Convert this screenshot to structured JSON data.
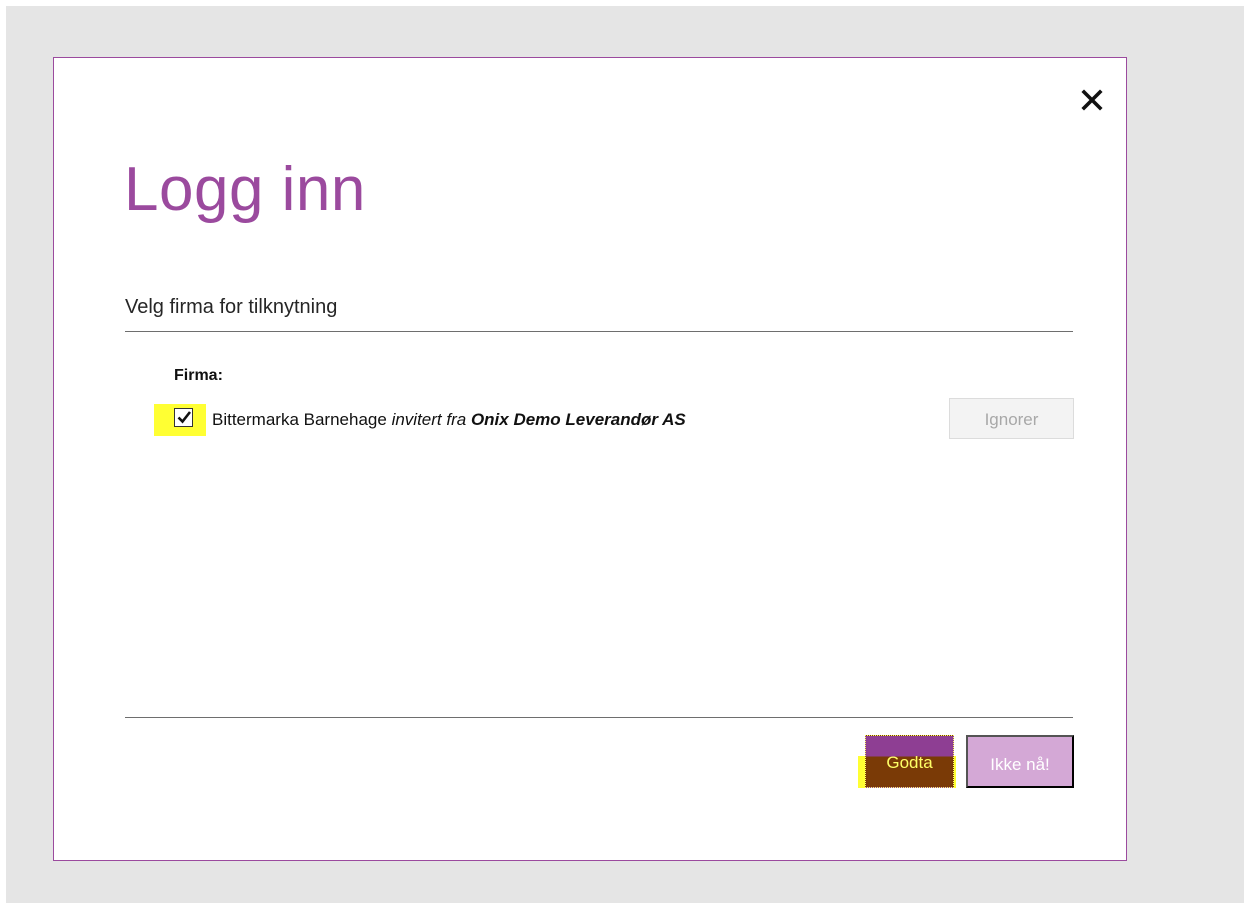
{
  "dialog": {
    "title": "Logg inn",
    "subtitle": "Velg firma for tilknytning",
    "close_icon": "close-icon"
  },
  "firm_section": {
    "label": "Firma:",
    "firm": {
      "checked": true,
      "name": "Bittermarka Barnehage",
      "invited_text": "invitert fra",
      "supplier": "Onix Demo Leverandør AS"
    },
    "ignore_label": "Ignorer"
  },
  "footer": {
    "accept_label": "Godta",
    "not_now_label": "Ikke nå!"
  },
  "colors": {
    "accent": "#9b4a9e",
    "highlight": "#ffff33",
    "backdrop": "#e5e5e5"
  }
}
